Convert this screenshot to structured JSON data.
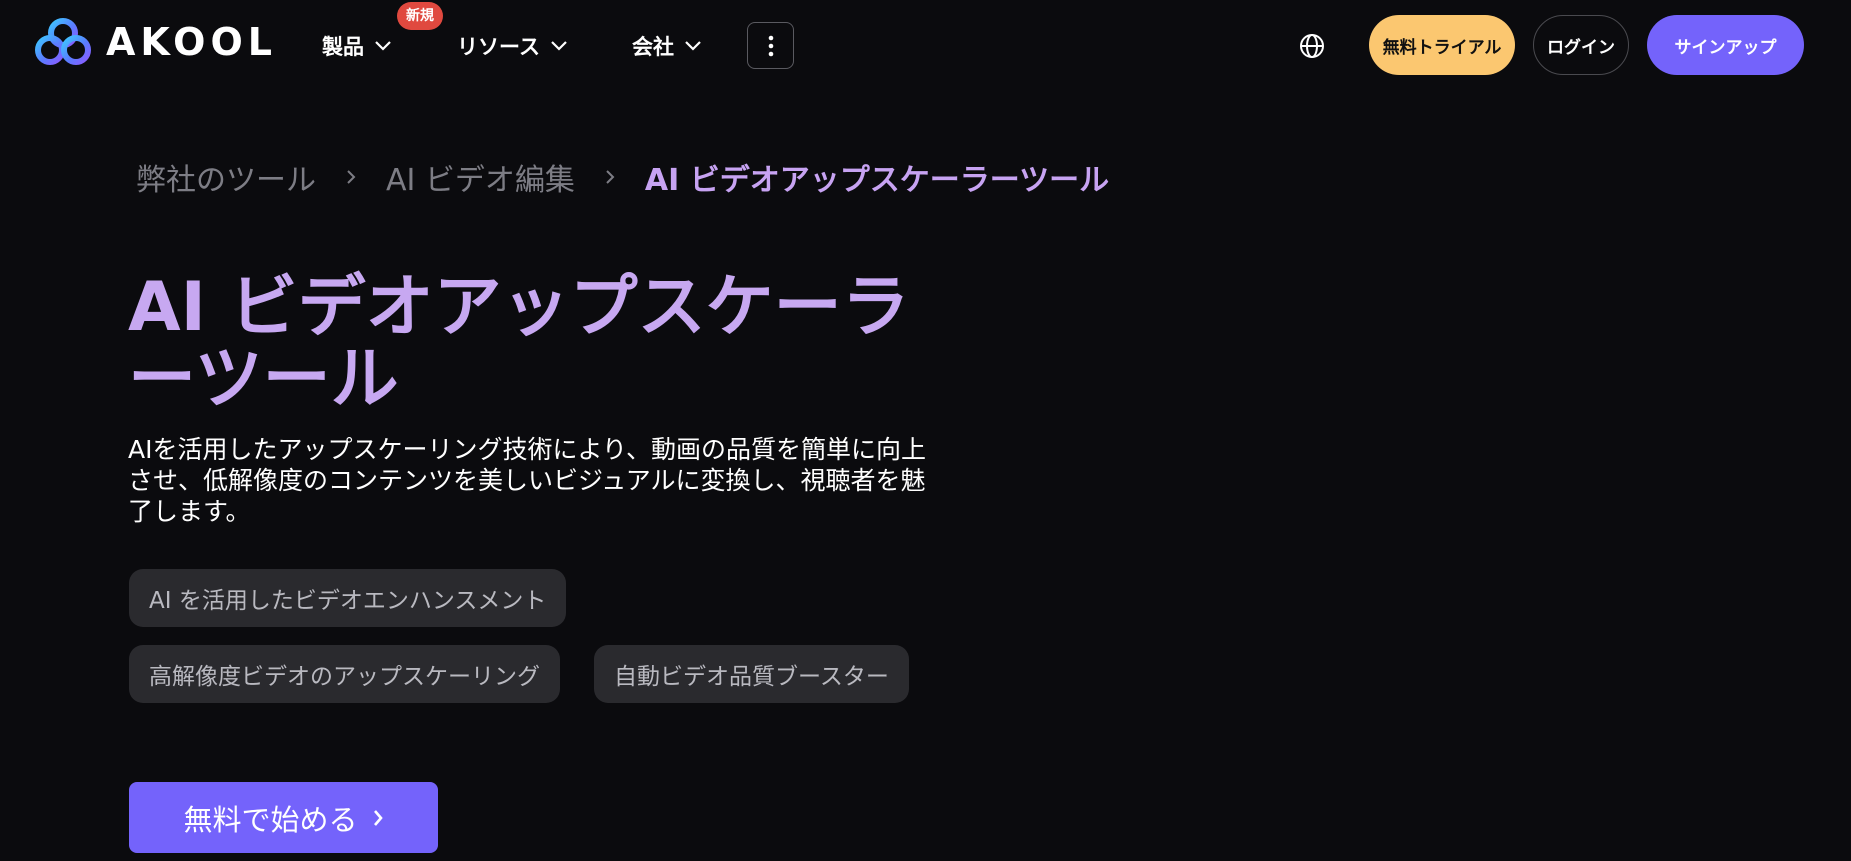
{
  "header": {
    "logo_text": "AKOOL",
    "nav": {
      "products_label": "製品",
      "new_badge": "新規",
      "resources_label": "リソース",
      "company_label": "会社"
    },
    "free_trial_label": "無料トライアル",
    "login_label": "ログイン",
    "signup_label": "サインアップ"
  },
  "breadcrumb": {
    "items": [
      "弊社のツール",
      "AI ビデオ編集",
      "AI ビデオアップスケーラーツール"
    ]
  },
  "hero": {
    "title_line1": "AI ビデオアップスケーラ",
    "title_line2": "ーツール",
    "description": "AIを活用したアップスケーリング技術により、動画の品質を簡単に向上させ、低解像度のコンテンツを美しいビジュアルに変換し、視聴者を魅了します。",
    "tags": [
      "AI を活用したビデオエンハンスメント",
      "高解像度ビデオのアップスケーリング",
      "自動ビデオ品質ブースター"
    ],
    "cta_label": "無料で始める"
  },
  "colors": {
    "background": "#0b0b0e",
    "accent_purple": "#7463fb",
    "title_lavender": "#c7a8f1",
    "trial_yellow": "#fbc770",
    "badge_red": "#e0493f"
  }
}
